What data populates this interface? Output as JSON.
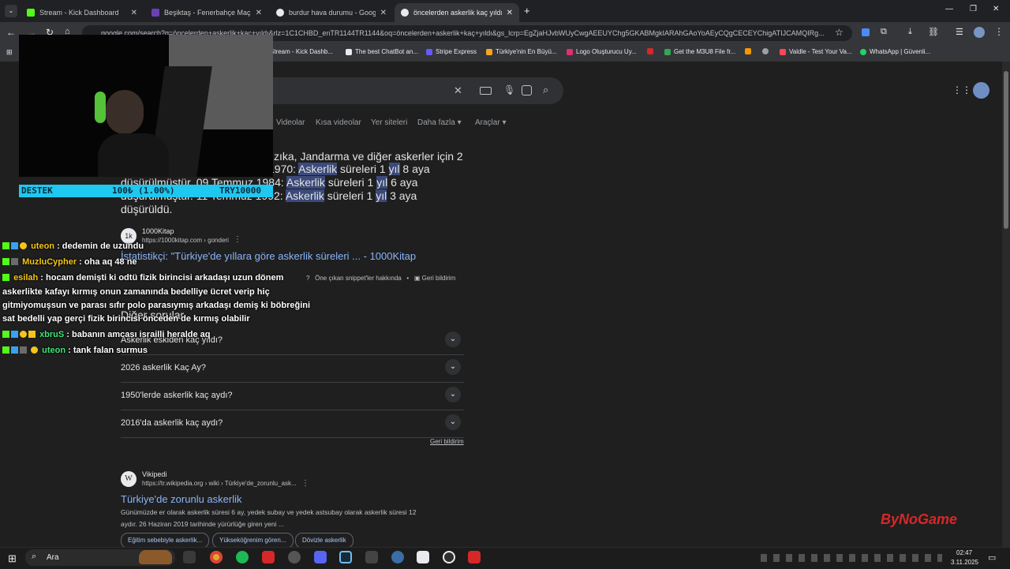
{
  "tabs": [
    {
      "label": "Stream - Kick Dashboard",
      "color": "#53fc18"
    },
    {
      "label": "Beşiktaş - Fenerbahçe Maç Öze",
      "color": "#6b3fb5"
    },
    {
      "label": "burdur hava durumu - Google",
      "color": "#e8eaed"
    },
    {
      "label": "öncelerden askerlik kaç yıldı - G",
      "color": "#e8eaed"
    }
  ],
  "omnibox": {
    "url": "google.com/search?q=öncelerden+askerlik+kaç+yıldı&rlz=1C1CHBD_enTR1144TR1144&oq=öncelerden+askerlik+kaç+yıldı&gs_lcrp=EgZjaHJvbWUyCwgAEEUYChg5GKABMgkIARAhGAoYoAEyCQgCECEYChigATIJCAMQIRg..."
  },
  "bookmarks": [
    {
      "label": "Stream - Kick Dashb...",
      "color": "#53fc18"
    },
    {
      "label": "The best ChatBot an...",
      "color": "#e8eaed"
    },
    {
      "label": "Stripe Express",
      "color": "#635bff"
    },
    {
      "label": "Türkiye'nin En Büyü...",
      "color": "#f5a623"
    },
    {
      "label": "Logo Oluşturucu Uy...",
      "color": "#e02f6b"
    },
    {
      "label": "",
      "color": "#d62828"
    },
    {
      "label": "Get the M3U8 File fr...",
      "color": "#34a853"
    },
    {
      "label": "",
      "color": "#f29900"
    },
    {
      "label": "",
      "color": "#9aa0a6"
    },
    {
      "label": "Valdle - Test Your Va...",
      "color": "#ff4655"
    },
    {
      "label": "WhatsApp | Güvenli...",
      "color": "#25d366"
    }
  ],
  "search_tabs": [
    "Videolar",
    "Kısa videolar",
    "Yer siteleri",
    "Daha fazla",
    "Araçlar"
  ],
  "snippet": {
    "line1": "lızıka, Jandarma ve diğer askerler için 2",
    "line2_a": "1970: ",
    "line2_b": "Askerlik",
    "line2_c": " süreleri 1 ",
    "line2_d": "yıl",
    "line2_e": " 8 aya",
    "line3_a": "düşürülmüştür. 09 Temmuz 1984: ",
    "line3_b": "Askerlik",
    "line3_c": " süreleri 1 ",
    "line3_d": "yıl",
    "line3_e": " 6 aya",
    "line4_a": "düşürülmüştür. 11 Temmuz 1992: ",
    "line4_b": "Askerlik",
    "line4_c": " süreleri 1 ",
    "line4_d": "yıl",
    "line4_e": " 3 aya",
    "line5": "düşürüldü."
  },
  "result1": {
    "site": "1000Kitap",
    "url": "https://1000kitap.com › gonderi",
    "title": "İstatistikçi: \"Türkiye'de yıllara göre askerlik süreleri ... - 1000Kitap",
    "about": "Öne çıkan snippet'ler hakkında",
    "feedback": "Geri bildirim"
  },
  "paa": {
    "heading": "Diğer sorular",
    "questions": [
      "Askerlik eskiden kaç yıldı?",
      "2026 askerlik Kaç Ay?",
      "1950'lerde askerlik kaç aydı?",
      "2016'da askerlik kaç aydı?"
    ],
    "feedback": "Geri bildirim"
  },
  "result2": {
    "site": "Vikipedi",
    "url": "https://tr.wikipedia.org › wiki › Türkiye'de_zorunlu_ask...",
    "title": "Türkiye'de zorunlu askerlik",
    "desc1": "Günümüzde er olarak askerlik süresi 6 ay, yedek subay ve yedek astsubay olarak askerlik süresi 12",
    "desc2": "aydır. 26 Haziran 2019 tarihinde yürürlüğe giren yeni ...",
    "chips": [
      "Eğitim sebebiyle askerlik...",
      "Yükseköğrenim gören...",
      "Dövizle askerlik"
    ]
  },
  "donation": {
    "label": "DESTEK",
    "amount": "100₺ (1.00%)",
    "goal": "TRY10000",
    "progress": 0.01
  },
  "chat": [
    {
      "user": "uteon",
      "msg": "dedemin de uzundu",
      "color": "#f5c518"
    },
    {
      "user": "MuzluCypher",
      "msg": "oha aq 48 ne",
      "color": "#f5c518"
    },
    {
      "user": "esilah",
      "msg": "hocam demişti ki odtü fizik birincisi arkadaşı uzun dönem",
      "color": "#f5c518"
    },
    {
      "user": "",
      "msg": "askerlikte kafayı kırmış onun zamanında bedelliye ücret verip hiç",
      "color": "#ffffff"
    },
    {
      "user": "",
      "msg": "gitmiyomuşsun ve parası sıfır polo parasıymış arkadaşı demiş ki böbreğini",
      "color": "#ffffff"
    },
    {
      "user": "",
      "msg": "sat bedelli yap gerçi fizik birincisi önceden de kırmış olabilir",
      "color": "#ffffff"
    },
    {
      "user": "xbruS",
      "msg": "babanın amcası israilli heralde aq",
      "color": "#3ee67a"
    },
    {
      "user": "uteon",
      "msg": "tank falan surmus",
      "color": "#3ee67a"
    }
  ],
  "taskbar": {
    "search": "Ara",
    "time": "02:47",
    "date": "3.11.2025"
  },
  "watermark": "ByNoGame"
}
